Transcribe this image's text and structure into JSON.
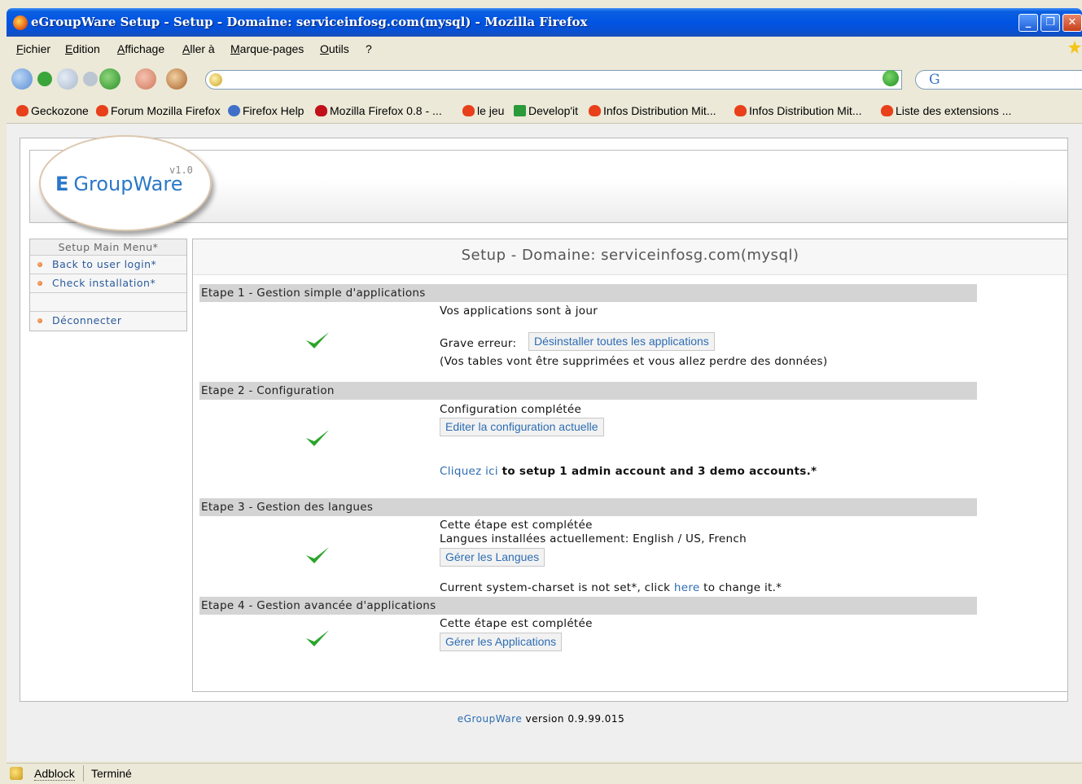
{
  "window": {
    "title": "eGroupWare Setup - Setup - Domaine: serviceinfosg.com(mysql) - Mozilla Firefox"
  },
  "menu": [
    "Fichier",
    "Edition",
    "Affichage",
    "Aller à",
    "Marque-pages",
    "Outils",
    "?"
  ],
  "urlbar": {
    "value": ""
  },
  "search": {
    "engine_glyph": "G"
  },
  "bookmarks": [
    "Geckozone",
    "Forum Mozilla Firefox",
    "Firefox Help",
    "Mozilla Firefox 0.8 - ...",
    "le jeu",
    "Develop'it",
    "Infos Distribution Mit...",
    "Infos Distribution Mit...",
    "Liste des extensions ..."
  ],
  "logo": {
    "version": "v1.0",
    "name": "GroupWare"
  },
  "sidebar": {
    "header": "Setup Main Menu*",
    "items": [
      "Back to user login*",
      "Check installation*",
      "",
      "Déconnecter"
    ]
  },
  "main": {
    "title": "Setup - Domaine: serviceinfosg.com(mysql)",
    "step1": {
      "header": "Etape 1 - Gestion simple d'applications",
      "status": "Vos applications sont à jour",
      "error_label": "Grave erreur:",
      "uninstall_button": "Désinstaller toutes les applications",
      "warning": "(Vos tables vont être supprimées et vous allez perdre des données)"
    },
    "step2": {
      "header": "Etape 2 - Configuration",
      "status": "Configuration complétée",
      "edit_button": "Editer la configuration actuelle",
      "click_link": "Cliquez ici",
      "click_rest": "to setup 1 admin account and 3 demo accounts.*"
    },
    "step3": {
      "header": "Etape 3 - Gestion des langues",
      "status": "Cette étape est complétée",
      "installed": "Langues installées actuellement: English / US, French",
      "manage_button": "Gérer les Langues",
      "charset_pre": "Current system-charset is not set*, click",
      "charset_link": "here",
      "charset_post": "to change it.*"
    },
    "step4": {
      "header": "Etape 4 - Gestion avancée d'applications",
      "status": "Cette étape est complétée",
      "manage_button": "Gérer les Applications"
    }
  },
  "footer": {
    "brand": "eGroupWare",
    "version_text": "version 0.9.99.015"
  },
  "statusbar": {
    "adblock": "Adblock",
    "status": "Terminé"
  },
  "colors": {
    "link": "#2d6db3",
    "check": "#2aa52a",
    "titlebar": "#0054e3"
  }
}
